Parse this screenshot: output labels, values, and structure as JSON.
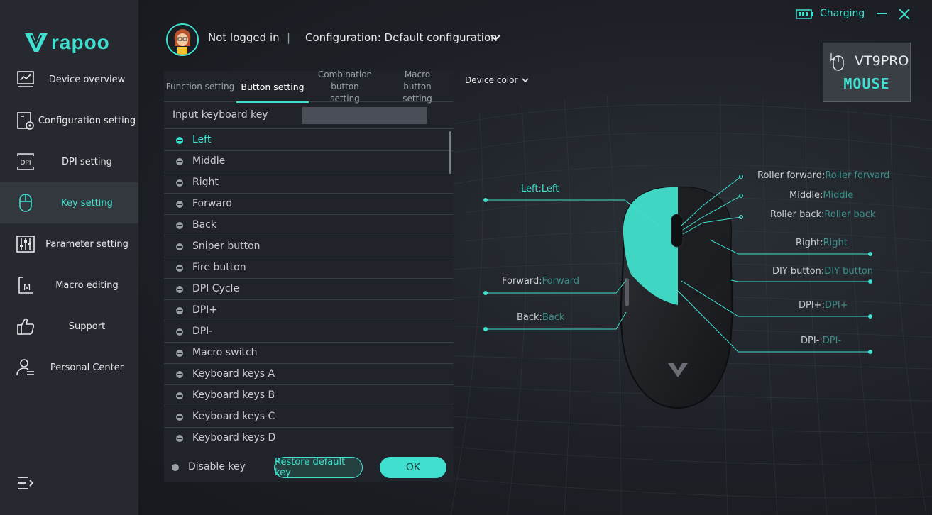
{
  "app": {
    "brand": "rapoo"
  },
  "sidebar": {
    "items": [
      {
        "label": "Device overview",
        "icon": "chart-icon"
      },
      {
        "label": "Configuration setting",
        "icon": "config-icon"
      },
      {
        "label": "DPI setting",
        "icon": "dpi-icon"
      },
      {
        "label": "Key setting",
        "icon": "mouse-icon",
        "active": true
      },
      {
        "label": "Parameter setting",
        "icon": "sliders-icon"
      },
      {
        "label": "Macro editing",
        "icon": "macro-icon"
      },
      {
        "label": "Support",
        "icon": "thumbs-up-icon"
      },
      {
        "label": "Personal Center",
        "icon": "user-icon"
      }
    ]
  },
  "header": {
    "user": "Not logged in",
    "separator": "|",
    "configuration": "Configuration: Default configuration",
    "status": "Charging"
  },
  "device": {
    "model": "VT9PRO",
    "type": "MOUSE"
  },
  "panel": {
    "tabs": [
      {
        "label": "Function setting"
      },
      {
        "label": "Button setting",
        "active": true
      },
      {
        "label": "Combination button setting"
      },
      {
        "label": "Macro button setting"
      }
    ],
    "input_label": "Input keyboard key",
    "input_value": "",
    "keys": [
      "Left",
      "Middle",
      "Right",
      "Forward",
      "Back",
      "Sniper button",
      "Fire button",
      "DPI Cycle",
      "DPI+",
      "DPI-",
      "Macro switch",
      "Keyboard keys A",
      "Keyboard keys B",
      "Keyboard keys C",
      "Keyboard keys D"
    ],
    "selected_key": "Left",
    "disable_label": "Disable key",
    "restore_label": "Restore default key",
    "ok_label": "OK"
  },
  "device_color": {
    "label": "Device color"
  },
  "callouts": {
    "left": {
      "key": "Left:",
      "value": "Left"
    },
    "roller_forward": {
      "key": "Roller forward:",
      "value": "Roller forward"
    },
    "middle": {
      "key": "Middle:",
      "value": "Middle"
    },
    "roller_back": {
      "key": "Roller back:",
      "value": "Roller back"
    },
    "right": {
      "key": "Right:",
      "value": "Right"
    },
    "diy": {
      "key": "DIY button:",
      "value": "DIY button"
    },
    "dpi_plus": {
      "key": "DPI+:",
      "value": "DPI+"
    },
    "dpi_minus": {
      "key": "DPI-:",
      "value": "DPI-"
    },
    "forward": {
      "key": "Forward:",
      "value": "Forward"
    },
    "back": {
      "key": "Back:",
      "value": "Back"
    }
  },
  "colors": {
    "accent": "#3fe0cf",
    "sidebar": "#26292f",
    "panel": "#202329"
  }
}
